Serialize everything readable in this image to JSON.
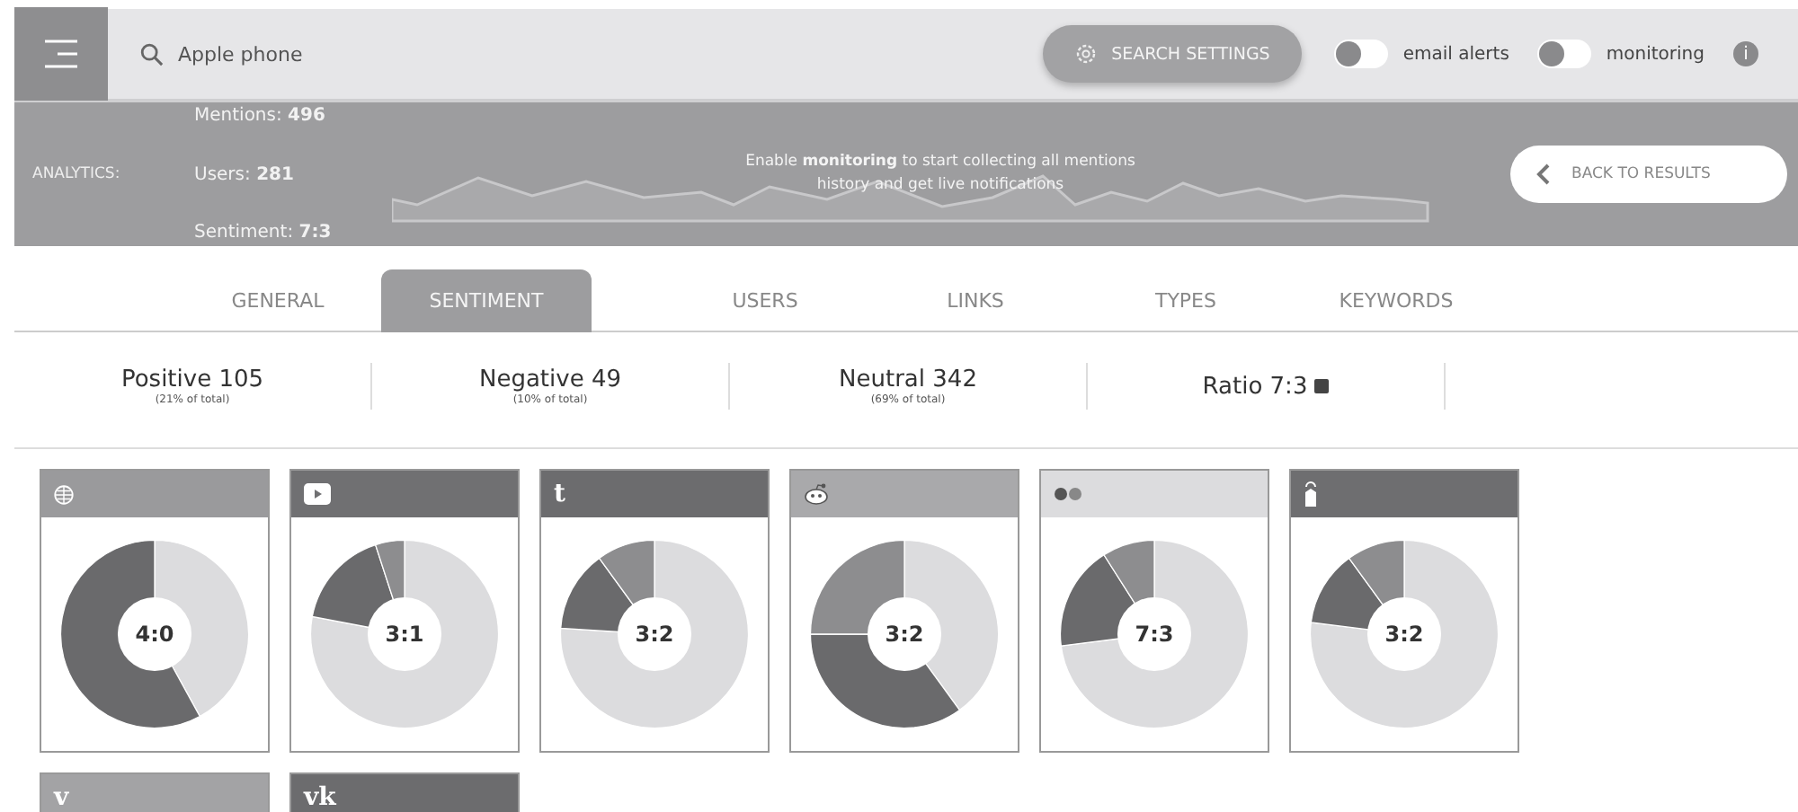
{
  "search": {
    "value": "Apple phone"
  },
  "search_settings": "SEARCH SETTINGS",
  "toggles": [
    {
      "label": "email alerts",
      "on": false
    },
    {
      "label": "monitoring",
      "on": false
    }
  ],
  "info": "i",
  "analytics": {
    "label": "ANALYTICS:",
    "stats": [
      "Mentions: **496**",
      "Users: **281**",
      "Sentiment: **7:3**"
    ],
    "notice": "Enable **monitoring** to start collecting all mentions history and get live notifications",
    "back": "BACK TO RESULTS"
  },
  "tabs": [
    {
      "label": "GENERAL",
      "selected": false
    },
    {
      "label": "SENTIMENT",
      "selected": true
    },
    {
      "label": "USERS",
      "selected": false
    },
    {
      "label": "LINKS",
      "selected": false
    },
    {
      "label": "TYPES",
      "selected": false
    },
    {
      "label": "KEYWORDS",
      "selected": false
    }
  ],
  "summary": [
    {
      "title": "Positive 105",
      "sub": "(21% of total)"
    },
    {
      "title": "Negative 49",
      "sub": "(10% of total)"
    },
    {
      "title": "Neutral 342",
      "sub": "(69% of total)"
    },
    {
      "title": "Ratio 7:3"
    }
  ],
  "cards": [
    {
      "kind": "globe",
      "color": "#9a9a9c",
      "ratio": "4:0"
    },
    {
      "kind": "play",
      "color": "#707072",
      "ratio": "3:1"
    },
    {
      "kind": "glyph",
      "glyph": "t",
      "color": "#6c6c6e",
      "ratio": "3:2"
    },
    {
      "kind": "robot",
      "color": "#a9a9ab",
      "ratio": "3:2"
    },
    {
      "kind": "dots",
      "color": "#dcdcde",
      "ratio": "7:3"
    },
    {
      "kind": "tag",
      "color": "#6e6e70",
      "ratio": "3:2"
    },
    {
      "kind": "glyph",
      "glyph": "v",
      "color": "#a3a3a5"
    },
    {
      "kind": "glyph",
      "glyph": "vk",
      "color": "#6c6c6e"
    }
  ]
}
